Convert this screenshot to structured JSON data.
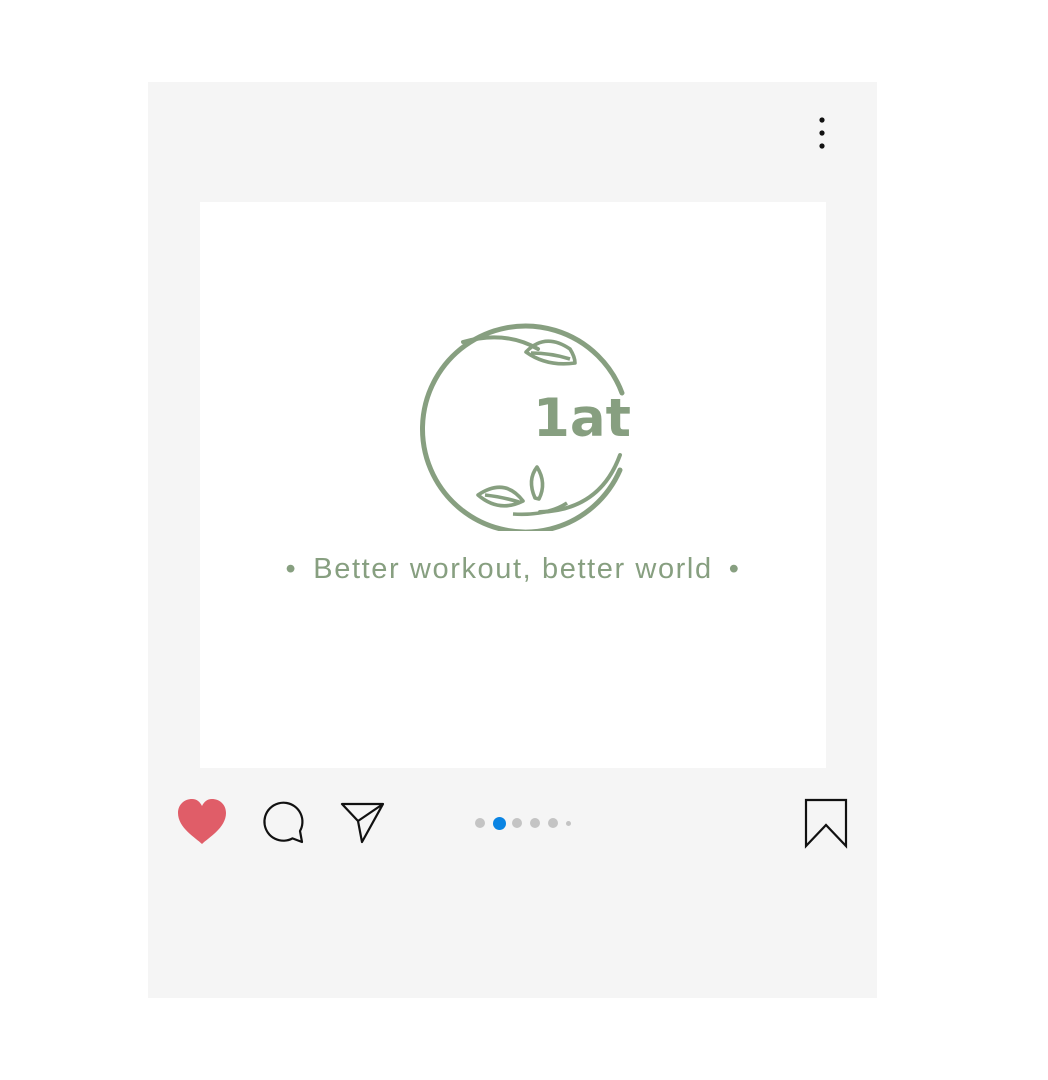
{
  "post": {
    "tagline": "Better workout, better world",
    "tagline_bullet": "•",
    "logo_text": "1at",
    "logo_color": "#879f80"
  },
  "colors": {
    "card_background": "#f5f5f5",
    "heart": "#e05d68",
    "dot_active": "#0a84e3",
    "dot_inactive": "#c4c4c4"
  },
  "actions": {
    "like_icon": "heart-icon",
    "liked": true,
    "comment_icon": "speech-bubble-icon",
    "share_icon": "paper-plane-icon",
    "save_icon": "bookmark-icon",
    "more_icon": "vertical-ellipsis-icon"
  },
  "carousel": {
    "total_dots": 6,
    "active_index": 1
  }
}
